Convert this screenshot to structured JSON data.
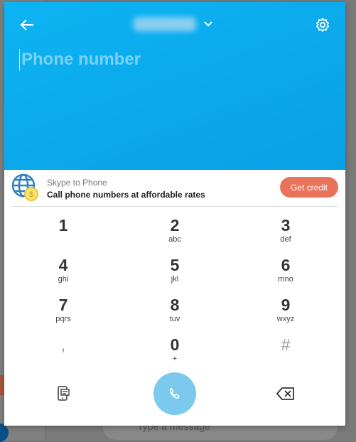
{
  "background": {
    "message_placeholder": "Type a message"
  },
  "header": {
    "phone_placeholder": "Phone number",
    "icons": [
      "arrow-left-icon",
      "chevron-down-icon",
      "gear-icon"
    ]
  },
  "promo": {
    "title": "Skype to Phone",
    "subtitle": "Call phone numbers at affordable rates",
    "button": "Get credit",
    "accent": "#e8735a"
  },
  "keypad": [
    {
      "digit": "1",
      "letters": ""
    },
    {
      "digit": "2",
      "letters": "abc"
    },
    {
      "digit": "3",
      "letters": "def"
    },
    {
      "digit": "4",
      "letters": "ghi"
    },
    {
      "digit": "5",
      "letters": "jkl"
    },
    {
      "digit": "6",
      "letters": "mno"
    },
    {
      "digit": "7",
      "letters": "pqrs"
    },
    {
      "digit": "8",
      "letters": "tuv"
    },
    {
      "digit": "9",
      "letters": "wxyz"
    },
    {
      "digit": ",",
      "letters": ""
    },
    {
      "digit": "0",
      "letters": "+"
    },
    {
      "digit": "#",
      "letters": ""
    }
  ],
  "colors": {
    "header": "#0cb4f2",
    "call_button": "#7bcaee"
  }
}
